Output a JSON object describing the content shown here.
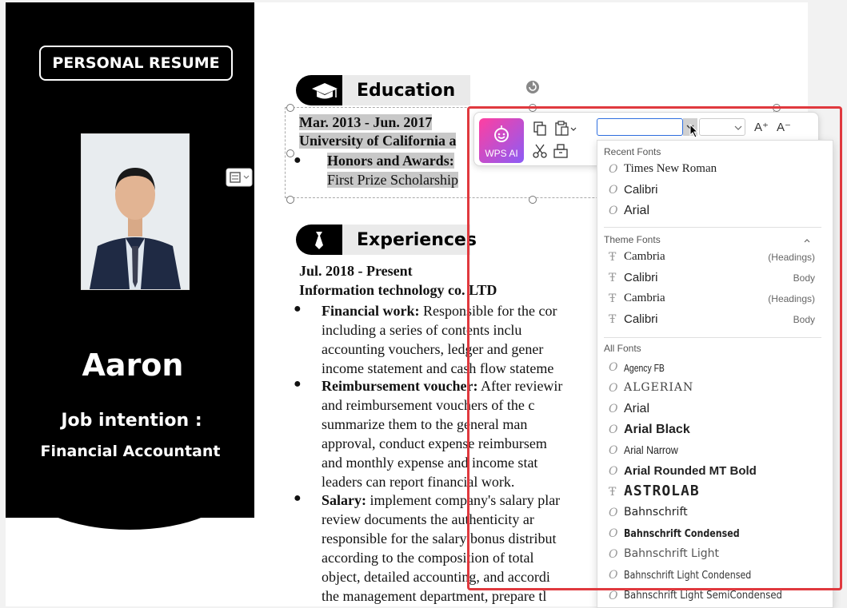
{
  "sidebar": {
    "badge": "PERSONAL RESUME",
    "name": "Aaron",
    "job_label": "Job intention :",
    "job_value": "Financial Accountant"
  },
  "education": {
    "title": "Education",
    "date": "Mar. 2013 - Jun. 2017",
    "school": "University of California a",
    "honors_label": "Honors and Awards:",
    "honors_value": "First Prize Scholarship"
  },
  "experiences": {
    "title": "Experiences",
    "date": "Jul. 2018 - Present",
    "company": "Information technology co. LTD",
    "items": [
      {
        "label": "Financial work:",
        "lines": [
          "Responsible for the cor",
          "including a series of contents inclu",
          "accounting vouchers, ledger and gener",
          "income statement and cash flow stateme"
        ]
      },
      {
        "label": "Reimbursement voucher:",
        "lines": [
          "After reviewir",
          "and reimbursement vouchers of the c",
          "summarize them to the general man",
          "approval, conduct expense reimbursem",
          "and monthly expense and income stat",
          "leaders can report financial work."
        ]
      },
      {
        "label": "Salary:",
        "lines": [
          "implement company's salary plar",
          "review documents the authenticity ar",
          "responsible for the salary bonus distribut",
          "according to the composition of total",
          "object, detailed accounting, and accordi",
          "the management department, prepare tl"
        ]
      }
    ]
  },
  "toolbar": {
    "wps_ai_label": "WPS AI",
    "font_value": "",
    "grow_font": "A⁺",
    "shrink_font": "A⁻"
  },
  "font_dropdown": {
    "recent_header": "Recent Fonts",
    "recent": [
      "Times New Roman",
      "Calibri",
      "Arial"
    ],
    "theme_header": "Theme Fonts",
    "theme": [
      {
        "name": "Cambria",
        "tag": "(Headings)"
      },
      {
        "name": "Calibri",
        "tag": "Body"
      },
      {
        "name": "Cambria",
        "tag": "(Headings)"
      },
      {
        "name": "Calibri",
        "tag": "Body"
      }
    ],
    "all_header": "All Fonts",
    "all": [
      "Agency FB",
      "ALGERIAN",
      "Arial",
      "Arial Black",
      "Arial Narrow",
      "Arial Rounded MT Bold",
      "ASTROLAB",
      "Bahnschrift",
      "Bahnschrift Condensed",
      "Bahnschrift Light",
      "Bahnschrift Light Condensed",
      "Bahnschrift Light SemiCondensed"
    ]
  },
  "colors": {
    "accent_frame": "#e0393e",
    "sidebar_bg": "#000000",
    "wps_ai_gradient_start": "#ff3fa0",
    "wps_ai_gradient_end": "#8b5cf6"
  }
}
